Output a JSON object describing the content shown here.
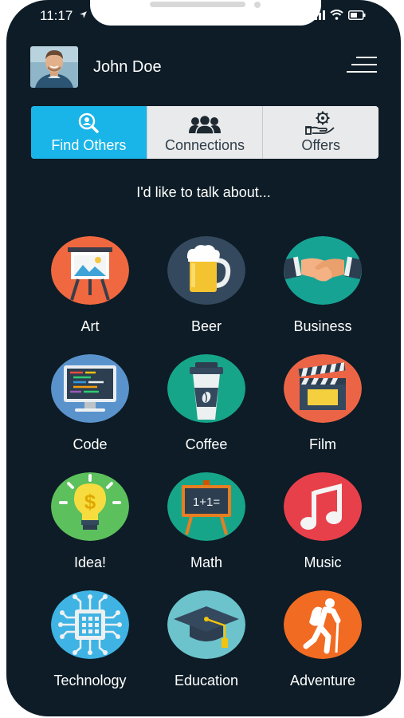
{
  "status": {
    "time": "11:17"
  },
  "user": {
    "name": "John Doe"
  },
  "tabs": [
    {
      "label": "Find Others",
      "icon": "search-people-icon",
      "active": true
    },
    {
      "label": "Connections",
      "icon": "group-icon",
      "active": false
    },
    {
      "label": "Offers",
      "icon": "offer-gear-hand-icon",
      "active": false
    }
  ],
  "prompt": "I'd like to talk about...",
  "topics": [
    {
      "label": "Art",
      "icon": "easel-icon",
      "color": "#f0683f"
    },
    {
      "label": "Beer",
      "icon": "beer-mug-icon",
      "color": "#34495e"
    },
    {
      "label": "Business",
      "icon": "handshake-icon",
      "color": "#16a394"
    },
    {
      "label": "Code",
      "icon": "monitor-code-icon",
      "color": "#5a93cc"
    },
    {
      "label": "Coffee",
      "icon": "coffee-cup-icon",
      "color": "#17a589"
    },
    {
      "label": "Film",
      "icon": "clapperboard-icon",
      "color": "#ec6446"
    },
    {
      "label": "Idea!",
      "icon": "lightbulb-icon",
      "color": "#5cc05c"
    },
    {
      "label": "Math",
      "icon": "chalkboard-icon",
      "color": "#17a589"
    },
    {
      "label": "Music",
      "icon": "music-note-icon",
      "color": "#e8404a"
    },
    {
      "label": "Technology",
      "icon": "chip-icon",
      "color": "#3fb3e4"
    },
    {
      "label": "Education",
      "icon": "graduation-cap-icon",
      "color": "#6cc3cc"
    },
    {
      "label": "Adventure",
      "icon": "hiker-icon",
      "color": "#f26b22"
    }
  ],
  "math_board_text": "1+1="
}
